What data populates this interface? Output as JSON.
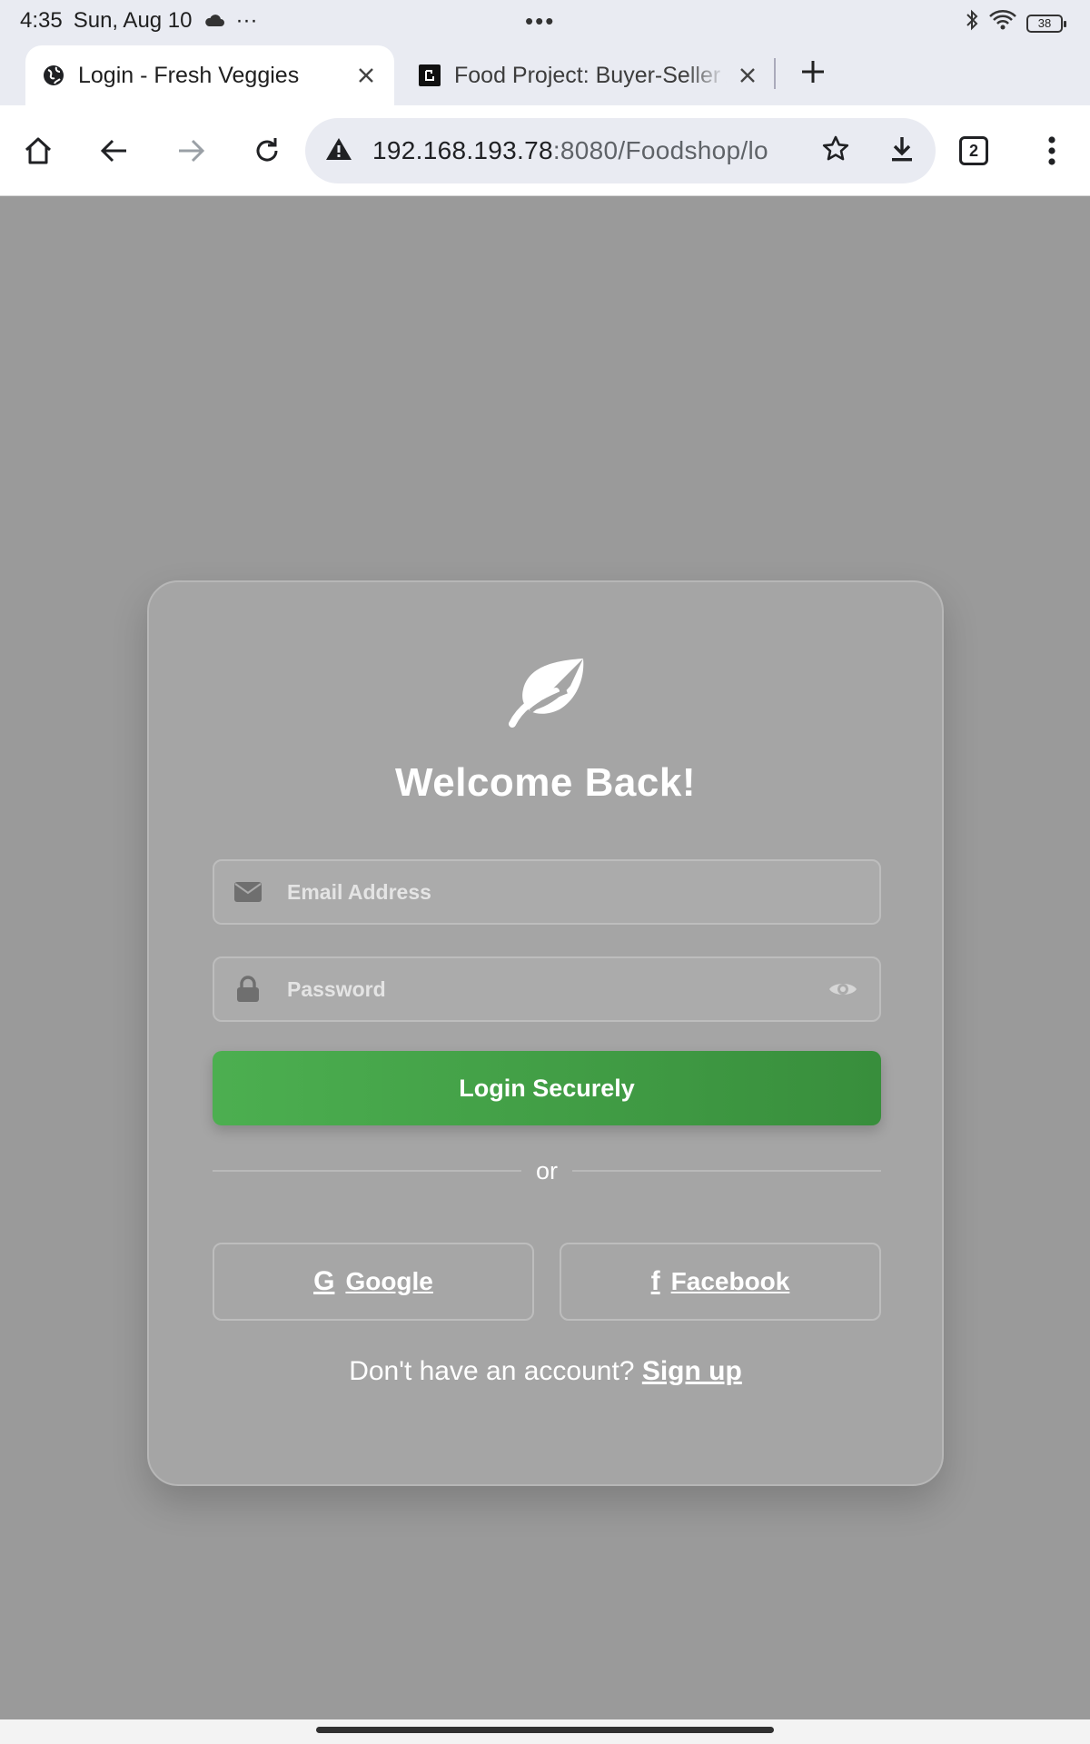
{
  "status_bar": {
    "time": "4:35",
    "date": "Sun, Aug 10",
    "more": "···",
    "center_dots": "•••",
    "battery": "38"
  },
  "tabs": [
    {
      "title": "Login - Fresh Veggies",
      "active": true
    },
    {
      "title": "Food Project: Buyer-Seller Ac",
      "active": false
    }
  ],
  "toolbar": {
    "url_host": "192.168.193.78",
    "url_path": ":8080/Foodshop/lo",
    "tab_count": "2"
  },
  "card": {
    "title": "Welcome Back!",
    "email_placeholder": "Email Address",
    "password_placeholder": "Password",
    "login_label": "Login Securely",
    "divider_text": "or",
    "google_label": "Google",
    "google_icon": "G",
    "facebook_label": "Facebook",
    "facebook_icon": "f",
    "signup_prompt": "Don't have an account?",
    "signup_link": "Sign up"
  },
  "colors": {
    "accent_green": "#4caf50",
    "accent_green_dark": "#388e3c",
    "page_overlay": "#9a9a9a"
  }
}
